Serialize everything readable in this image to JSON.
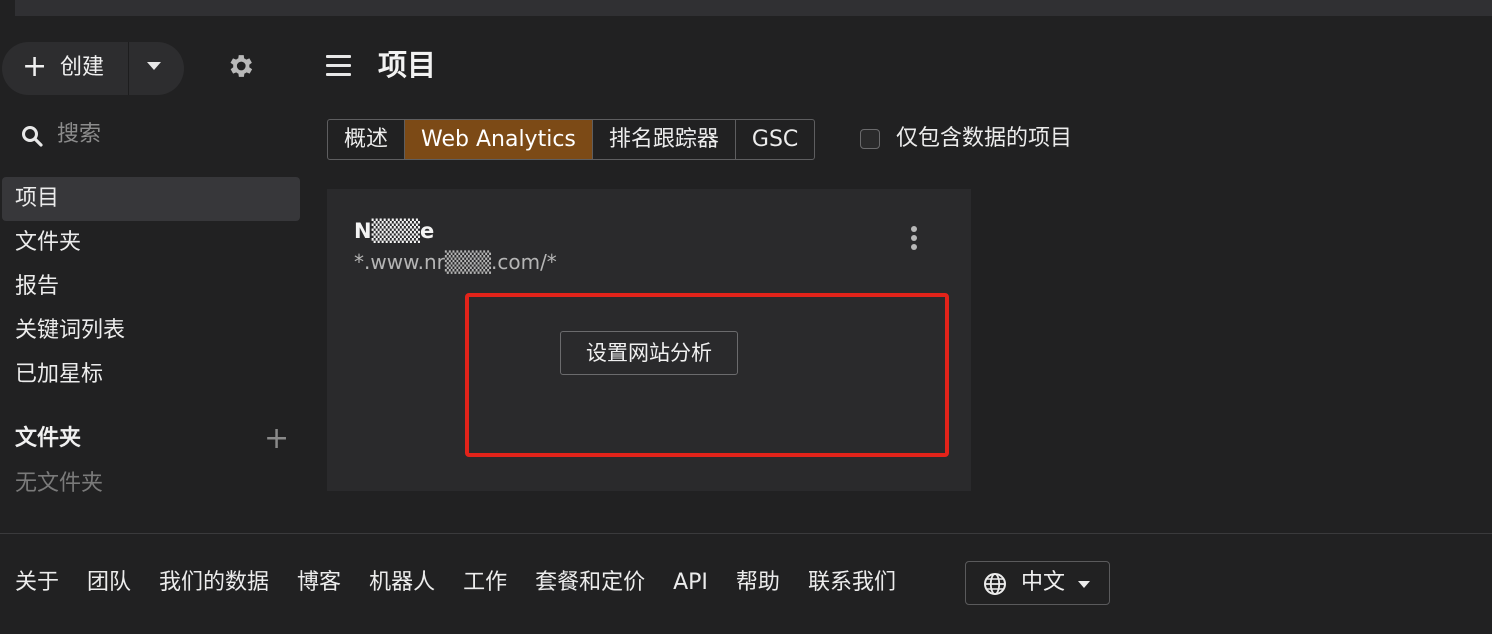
{
  "sidebar": {
    "create_label": "创建",
    "search_placeholder": "搜索",
    "nav_items": [
      {
        "label": "项目",
        "active": true
      },
      {
        "label": "文件夹"
      },
      {
        "label": "报告"
      },
      {
        "label": "关键词列表"
      },
      {
        "label": "已加星标"
      }
    ],
    "folders_heading": "文件夹",
    "no_folders": "无文件夹"
  },
  "main": {
    "title": "项目",
    "tabs": [
      {
        "label": "概述"
      },
      {
        "label": "Web Analytics",
        "selected": true
      },
      {
        "label": "排名跟踪器"
      },
      {
        "label": "GSC"
      }
    ],
    "filter_checkbox_label": "仅包含数据的项目",
    "filter_checked": false,
    "project_card": {
      "name": "N▒▒▒e",
      "url": "*.www.nr▒▒▒.com/*",
      "setup_button": "设置网站分析"
    }
  },
  "footer": {
    "links": [
      "关于",
      "团队",
      "我们的数据",
      "博客",
      "机器人",
      "工作",
      "套餐和定价",
      "API",
      "帮助",
      "联系我们"
    ],
    "language": "中文"
  },
  "colors": {
    "background": "#212122",
    "tab_selected": "#7c4a16",
    "highlight_box": "#e2231a"
  },
  "icons": [
    "plus-icon",
    "caret-down-icon",
    "gear-icon",
    "search-icon",
    "hamburger-icon",
    "more-vertical-icon",
    "globe-icon"
  ]
}
